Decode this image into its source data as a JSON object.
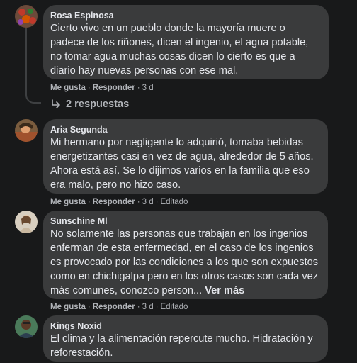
{
  "comments": [
    {
      "author": "Rosa Espinosa",
      "text": "Cierto vivo en un pueblo donde la mayoría muere o padece de los riñones, dicen el ingenio, el agua potable, no tomar agua muchas cosas dicen lo cierto es que a diario hay nuevas personas con ese mal.",
      "like": "Me gusta",
      "reply": "Responder",
      "time": "3 d",
      "edited": "",
      "replies_label": "2 respuestas"
    },
    {
      "author": "Aria Segunda",
      "text": "Mi hermano por negligente lo adquirió, tomaba bebidas energetizantes casi en vez de agua, alrededor de 5 años. Ahora está así. Se lo dijimos varios en la familia que eso era malo, pero no hizo caso.",
      "like": "Me gusta",
      "reply": "Responder",
      "time": "3 d",
      "edited": "Editado"
    },
    {
      "author": "Sunschine Ml",
      "text": "No solamente las personas que trabajan en los ingenios enferman de esta enfermedad, en el caso de los ingenios es provocado por las condiciones a los que son expuestos como en chichigalpa pero en los otros casos son cada vez más comunes, conozco person...",
      "see_more": "Ver más",
      "like": "Me gusta",
      "reply": "Responder",
      "time": "3 d",
      "edited": "Editado"
    },
    {
      "author": "Kings Noxid",
      "text": "El clima y la alimentación repercute mucho. Hidratación y reforestación."
    }
  ]
}
